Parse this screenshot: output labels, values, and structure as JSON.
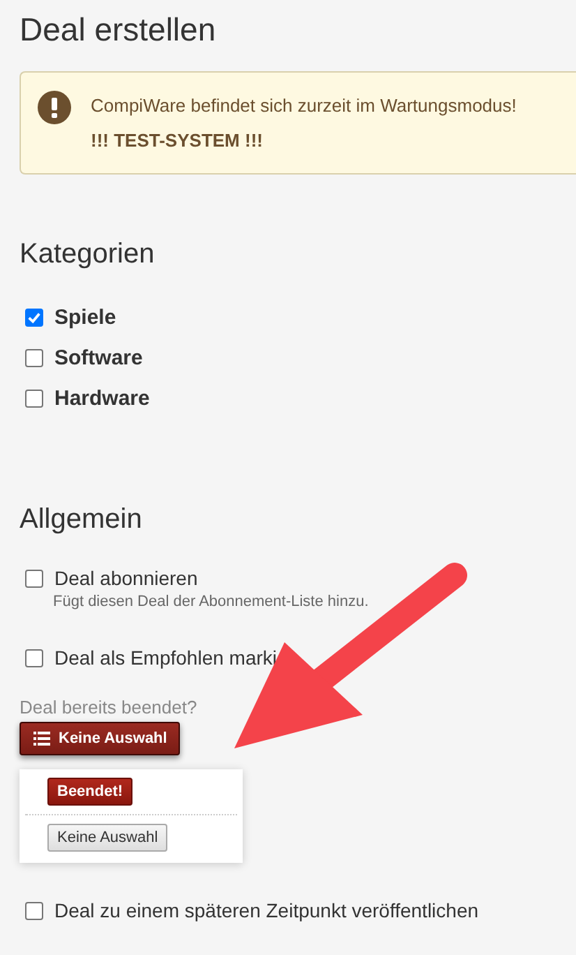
{
  "page_title": "Deal erstellen",
  "alert": {
    "lines": [
      "CompiWare befindet sich zurzeit im Wartungsmodus!",
      "!!! TEST-SYSTEM !!!"
    ]
  },
  "categories": {
    "heading": "Kategorien",
    "items": [
      {
        "label": "Spiele",
        "checked": true
      },
      {
        "label": "Software",
        "checked": false
      },
      {
        "label": "Hardware",
        "checked": false
      }
    ]
  },
  "general": {
    "heading": "Allgemein",
    "fields": [
      {
        "kind": "checkbox",
        "label": "Deal abonnieren",
        "checked": false,
        "hint": "Fügt diesen Deal der Abonnement-Liste hinzu."
      },
      {
        "kind": "checkbox",
        "label": "Deal als Empfohlen marki",
        "checked": false
      },
      {
        "kind": "dropdown",
        "label": "Deal bereits beendet?",
        "button": "Keine Auswahl",
        "expanded": true,
        "menu": [
          {
            "label": "Beendet!",
            "kind": "danger"
          },
          {
            "label": "Keine Auswahl",
            "kind": "default"
          }
        ]
      },
      {
        "kind": "checkbox",
        "label": "Deal zu einem späteren Zeitpunkt veröffentlichen",
        "checked": false
      }
    ]
  }
}
